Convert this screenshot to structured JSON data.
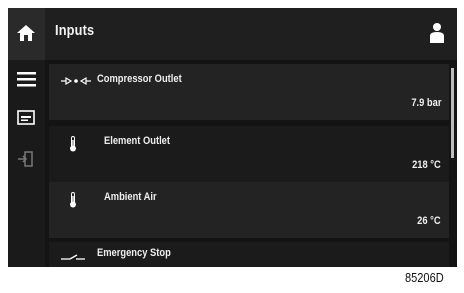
{
  "header": {
    "title": "Inputs"
  },
  "sidebar": {
    "icons": [
      "menu-icon",
      "display-icon",
      "logout-icon"
    ]
  },
  "inputs": [
    {
      "label": "Compressor Outlet",
      "value": "7.9 bar",
      "icon": "pressure-arrows-icon"
    },
    {
      "label": "Element Outlet",
      "value": "218 °C",
      "icon": "thermometer-icon"
    },
    {
      "label": "Ambient Air",
      "value": "26 °C",
      "icon": "thermometer-icon"
    },
    {
      "label": "Emergency Stop",
      "value": "",
      "icon": "switch-icon"
    }
  ],
  "figure_code": "85206D"
}
